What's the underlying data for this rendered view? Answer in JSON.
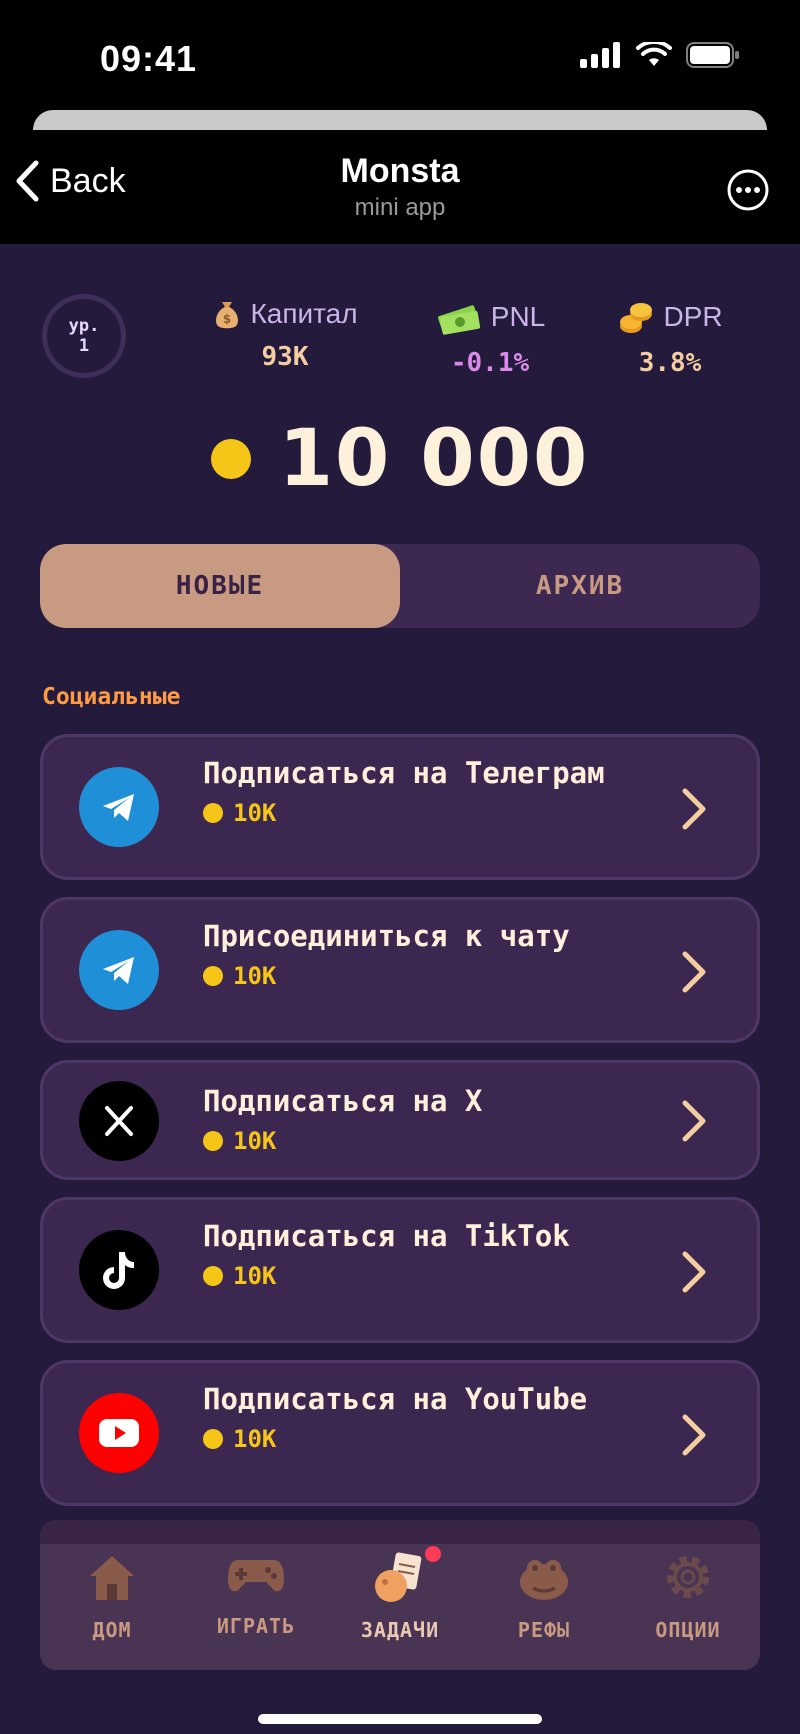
{
  "status_bar": {
    "time": "09:41"
  },
  "nav": {
    "back_label": "Back",
    "title": "Monsta",
    "subtitle": "mini app"
  },
  "level": {
    "label": "ур.",
    "value": "1"
  },
  "stats": [
    {
      "label": "Капитал",
      "value": "93K",
      "value_color": "#f4cda0",
      "icon": "money-bag-icon"
    },
    {
      "label": "PNL",
      "value": "-0.1%",
      "value_color": "#d98ae8",
      "icon": "cash-icon"
    },
    {
      "label": "DPR",
      "value": "3.8%",
      "value_color": "#f4cda0",
      "icon": "coins-icon"
    }
  ],
  "balance": "10 000",
  "tabs": {
    "new": "НОВЫЕ",
    "archive": "АРХИВ",
    "active": "new"
  },
  "section_title": "Социальные",
  "tasks": [
    {
      "title": "Подписаться на Телеграм",
      "reward": "10K",
      "icon": "telegram-icon",
      "icon_bg": "#1f8fd8"
    },
    {
      "title": "Присоединиться к чату",
      "reward": "10K",
      "icon": "telegram-icon",
      "icon_bg": "#1f8fd8"
    },
    {
      "title": "Подписаться на X",
      "reward": "10K",
      "icon": "x-icon",
      "icon_bg": "#000000"
    },
    {
      "title": "Подписаться на TikTok",
      "reward": "10K",
      "icon": "tiktok-icon",
      "icon_bg": "#000000"
    },
    {
      "title": "Подписаться на YouTube",
      "reward": "10K",
      "icon": "youtube-icon",
      "icon_bg": "#ff0000"
    }
  ],
  "tabbar": [
    {
      "label": "ДОМ",
      "icon": "house-icon"
    },
    {
      "label": "ИГРАТЬ",
      "icon": "gamepad-icon"
    },
    {
      "label": "ЗАДАЧИ",
      "icon": "tasks-icon",
      "active": true,
      "badge": true
    },
    {
      "label": "РЕФЫ",
      "icon": "friends-icon"
    },
    {
      "label": "ОПЦИИ",
      "icon": "gear-icon"
    }
  ],
  "colors": {
    "background": "#241a3c",
    "card": "#3c2750",
    "accent": "#c99a82",
    "coin": "#f5c518",
    "section": "#ff9a45"
  }
}
